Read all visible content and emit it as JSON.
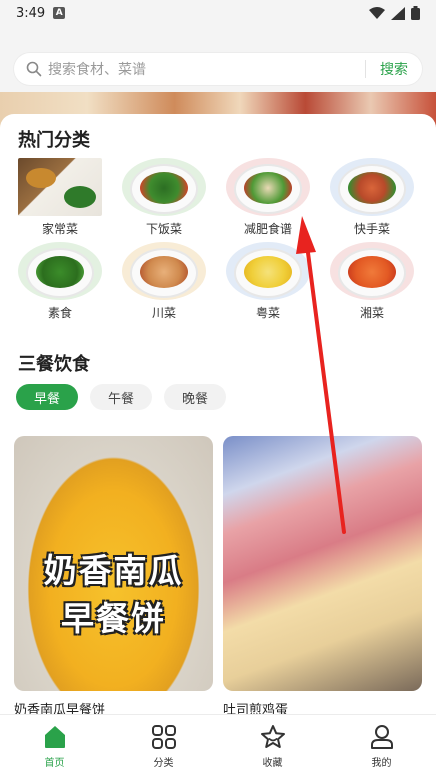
{
  "status_bar": {
    "time": "3:49"
  },
  "search": {
    "placeholder": "搜索食材、菜谱",
    "button_label": "搜索"
  },
  "hot_categories": {
    "title": "热门分类",
    "items": [
      {
        "label": "家常菜",
        "icon": "home-cooking-dish"
      },
      {
        "label": "下饭菜",
        "icon": "rice-dish"
      },
      {
        "label": "减肥食谱",
        "icon": "diet-dish"
      },
      {
        "label": "快手菜",
        "icon": "quick-dish"
      },
      {
        "label": "素食",
        "icon": "vegetarian-dish"
      },
      {
        "label": "川菜",
        "icon": "sichuan-dish"
      },
      {
        "label": "粤菜",
        "icon": "cantonese-dish"
      },
      {
        "label": "湘菜",
        "icon": "hunan-dish"
      }
    ]
  },
  "meals": {
    "title": "三餐饮食",
    "tabs": [
      {
        "label": "早餐",
        "active": true
      },
      {
        "label": "午餐",
        "active": false
      },
      {
        "label": "晚餐",
        "active": false
      }
    ]
  },
  "recipes": [
    {
      "title": "奶香南瓜早餐饼",
      "overlay_line1": "奶香南瓜",
      "overlay_line2": "早餐饼"
    },
    {
      "title": "吐司煎鸡蛋"
    }
  ],
  "bottom_nav": [
    {
      "label": "首页",
      "icon": "home-icon",
      "active": true
    },
    {
      "label": "分类",
      "icon": "grid-icon",
      "active": false
    },
    {
      "label": "收藏",
      "icon": "star-icon",
      "active": false
    },
    {
      "label": "我的",
      "icon": "user-icon",
      "active": false
    }
  ],
  "colors": {
    "accent": "#2aa24a",
    "annotation_arrow": "#e8231f"
  }
}
